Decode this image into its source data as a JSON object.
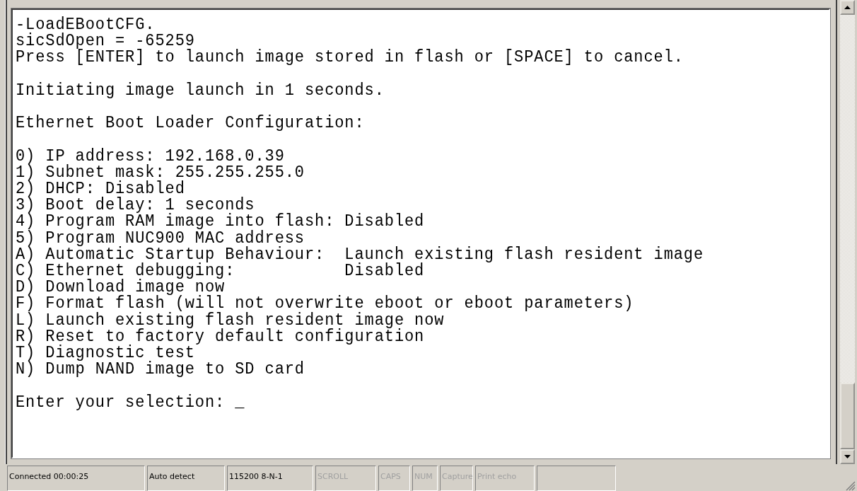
{
  "terminal": {
    "blocks": [
      [
        "-LoadEBootCFG.",
        "sicSdOpen = -65259",
        "Press [ENTER] to launch image stored in flash or [SPACE] to cancel."
      ],
      [
        "Initiating image launch in 1 seconds."
      ],
      [
        "Ethernet Boot Loader Configuration:"
      ],
      [
        "0) IP address: 192.168.0.39",
        "1) Subnet mask: 255.255.255.0",
        "2) DHCP: Disabled",
        "3) Boot delay: 1 seconds",
        "4) Program RAM image into flash: Disabled",
        "5) Program NUC900 MAC address",
        "A) Automatic Startup Behaviour:  Launch existing flash resident image",
        "C) Ethernet debugging:           Disabled",
        "D) Download image now",
        "F) Format flash (will not overwrite eboot or eboot parameters)",
        "L) Launch existing flash resident image now",
        "R) Reset to factory default configuration",
        "T) Diagnostic test",
        "N) Dump NAND image to SD card"
      ],
      [
        "Enter your selection: _"
      ]
    ]
  },
  "status_bar": {
    "panels": [
      {
        "text": "Connected 00:00:25",
        "disabled": false
      },
      {
        "text": "Auto detect",
        "disabled": false
      },
      {
        "text": "115200 8-N-1",
        "disabled": false
      },
      {
        "text": "SCROLL",
        "disabled": true
      },
      {
        "text": "CAPS",
        "disabled": true
      },
      {
        "text": "NUM",
        "disabled": true
      },
      {
        "text": "Capture",
        "disabled": true
      },
      {
        "text": "Print echo",
        "disabled": true
      }
    ]
  }
}
